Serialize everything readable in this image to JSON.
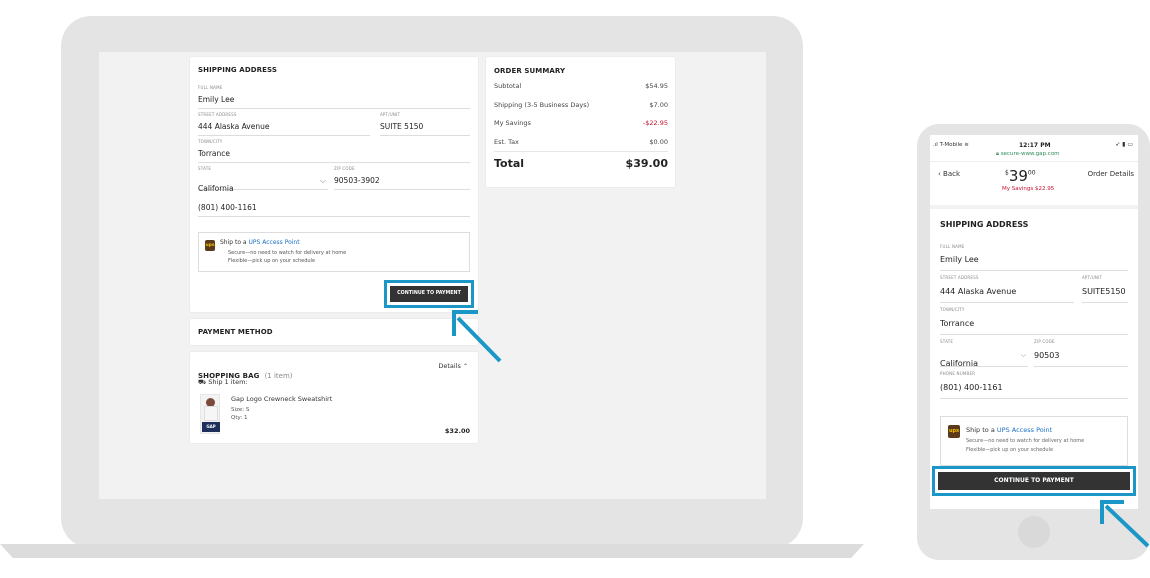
{
  "desktop": {
    "shipping": {
      "title": "SHIPPING ADDRESS",
      "full_name_label": "FULL NAME",
      "full_name": "Emily Lee",
      "street_label": "STREET ADDRESS",
      "street": "444 Alaska Avenue",
      "apt_label": "APT/UNIT",
      "apt": "SUITE 5150",
      "city_label": "TOWN/CITY",
      "city": "Torrance",
      "state_label": "STATE",
      "state": "California",
      "zip_label": "ZIP CODE",
      "zip": "90503-3902",
      "phone": "(801) 400-1161",
      "ups_prefix": "Ship to a ",
      "ups_link": "UPS Access Point",
      "ups_line1": "Secure—no need to watch for delivery at home",
      "ups_line2": "Flexible—pick up on your schedule",
      "ups_logo": "ups",
      "continue_label": "CONTINUE TO PAYMENT"
    },
    "payment": {
      "title": "PAYMENT METHOD"
    },
    "bag": {
      "title": "SHOPPING BAG",
      "count": "(1 item)",
      "details": "Details",
      "ship_line": "Ship 1 item:",
      "item_name": "Gap Logo Crewneck Sweatshirt",
      "item_size": "Size: S",
      "item_qty": "Qty: 1",
      "item_price": "$32.00",
      "thumb_brand": "GAP"
    },
    "summary": {
      "title": "ORDER SUMMARY",
      "rows": [
        {
          "label": "Subtotal",
          "value": "$54.95"
        },
        {
          "label": "Shipping (3-5 Business Days)",
          "value": "$7.00"
        },
        {
          "label": "My Savings",
          "value": "-$22.95"
        },
        {
          "label": "Est. Tax",
          "value": "$0.00"
        }
      ],
      "total_label": "Total",
      "total_value": "$39.00"
    }
  },
  "mobile": {
    "status": {
      "carrier": "T-Mobile",
      "time": "12:17 PM",
      "url": "secure-www.gap.com"
    },
    "nav": {
      "back": "Back",
      "price_dollar": "$",
      "price_main": "39",
      "price_cents": "00",
      "savings": "My Savings $22.95",
      "order_details": "Order Details"
    },
    "shipping": {
      "title": "SHIPPING ADDRESS",
      "full_name_label": "FULL NAME",
      "full_name": "Emily Lee",
      "street_label": "STREET ADDRESS",
      "street": "444 Alaska Avenue",
      "apt_label": "APT/UNIT",
      "apt": "SUITE5150",
      "city_label": "TOWN/CITY",
      "city": "Torrance",
      "state_label": "STATE",
      "state": "California",
      "zip_label": "ZIP CODE",
      "zip": "90503",
      "phone_label": "PHONE NUMBER",
      "phone": "(801) 400-1161",
      "ups_prefix": "Ship to a ",
      "ups_link": "UPS Access Point",
      "ups_line1": "Secure—no need to watch for delivery at home",
      "ups_line2": "Flexible—pick up on your schedule",
      "ups_logo": "ups",
      "continue_label": "CONTINUE TO PAYMENT"
    }
  },
  "colors": {
    "highlight": "#1a97c7",
    "savings_red": "#c8102e",
    "button_dark": "#333333",
    "link_blue": "#1a6fc7"
  }
}
